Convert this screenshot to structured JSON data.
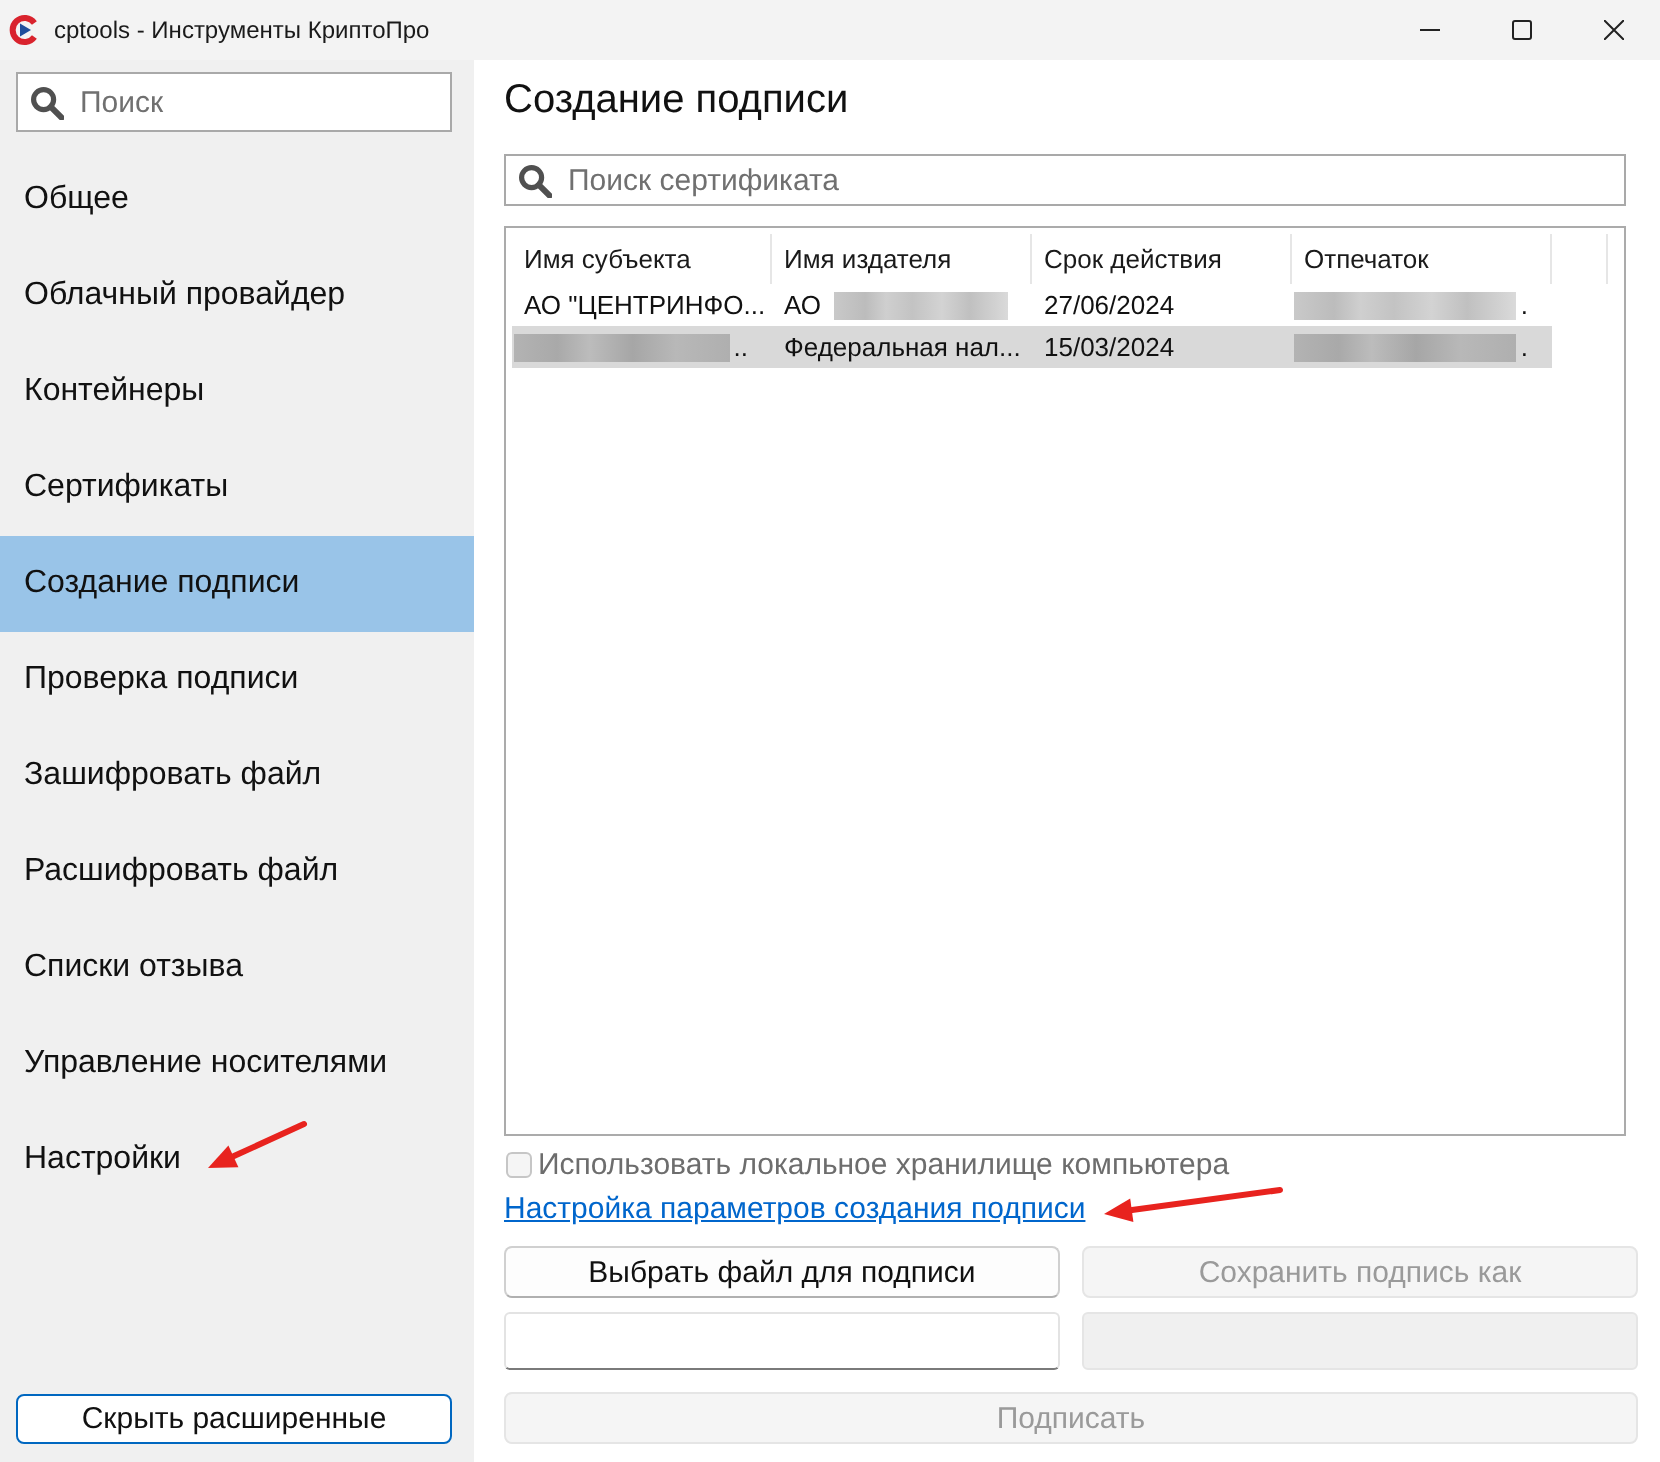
{
  "window": {
    "title": "cptools - Инструменты КриптоПро"
  },
  "sidebar": {
    "search": {
      "placeholder": "Поиск"
    },
    "items": [
      {
        "label": "Общее",
        "selected": false,
        "marked_with_arrow": false
      },
      {
        "label": "Облачный провайдер",
        "selected": false,
        "marked_with_arrow": false
      },
      {
        "label": "Контейнеры",
        "selected": false,
        "marked_with_arrow": false
      },
      {
        "label": "Сертификаты",
        "selected": false,
        "marked_with_arrow": false
      },
      {
        "label": "Создание подписи",
        "selected": true,
        "marked_with_arrow": false
      },
      {
        "label": "Проверка подписи",
        "selected": false,
        "marked_with_arrow": false
      },
      {
        "label": "Зашифровать файл",
        "selected": false,
        "marked_with_arrow": false
      },
      {
        "label": "Расшифровать файл",
        "selected": false,
        "marked_with_arrow": false
      },
      {
        "label": "Списки отзыва",
        "selected": false,
        "marked_with_arrow": false
      },
      {
        "label": "Управление носителями",
        "selected": false,
        "marked_with_arrow": false
      },
      {
        "label": "Настройки",
        "selected": false,
        "marked_with_arrow": true
      }
    ],
    "toggle_button": "Скрыть расширенные"
  },
  "main": {
    "title": "Создание подписи",
    "search": {
      "placeholder": "Поиск сертификата"
    },
    "table": {
      "columns": [
        "Имя субъекта",
        "Имя издателя",
        "Срок действия",
        "Отпечаток"
      ],
      "rows": [
        {
          "selected": false,
          "cells": [
            [
              {
                "kind": "text",
                "text": "АО \"ЦЕНТРИНФО..."
              }
            ],
            [
              {
                "kind": "text",
                "text": "АО"
              },
              {
                "kind": "blur"
              }
            ],
            [
              {
                "kind": "text",
                "text": "27/06/2024"
              }
            ],
            [
              {
                "kind": "blur"
              },
              {
                "kind": "text",
                "text": "."
              }
            ]
          ]
        },
        {
          "selected": true,
          "cells": [
            [
              {
                "kind": "blur"
              },
              {
                "kind": "text",
                "text": ".."
              }
            ],
            [
              {
                "kind": "text",
                "text": "Федеральная нал..."
              }
            ],
            [
              {
                "kind": "text",
                "text": "15/03/2024"
              }
            ],
            [
              {
                "kind": "blur"
              },
              {
                "kind": "text",
                "text": "."
              }
            ]
          ]
        }
      ]
    },
    "local_store": {
      "label": "Использовать локальное хранилище компьютера",
      "checked": false,
      "disabled": true
    },
    "settings_link": {
      "label": "Настройка параметров создания подписи",
      "marked_with_arrow": true
    },
    "choose_file_button": {
      "label": "Выбрать файл для подписи",
      "disabled": false
    },
    "save_button": {
      "label": "Сохранить подпись как",
      "disabled": true
    },
    "fields": [
      {
        "disabled": false
      },
      {
        "disabled": true
      }
    ],
    "sign_button": {
      "label": "Подписать",
      "disabled": true
    }
  }
}
